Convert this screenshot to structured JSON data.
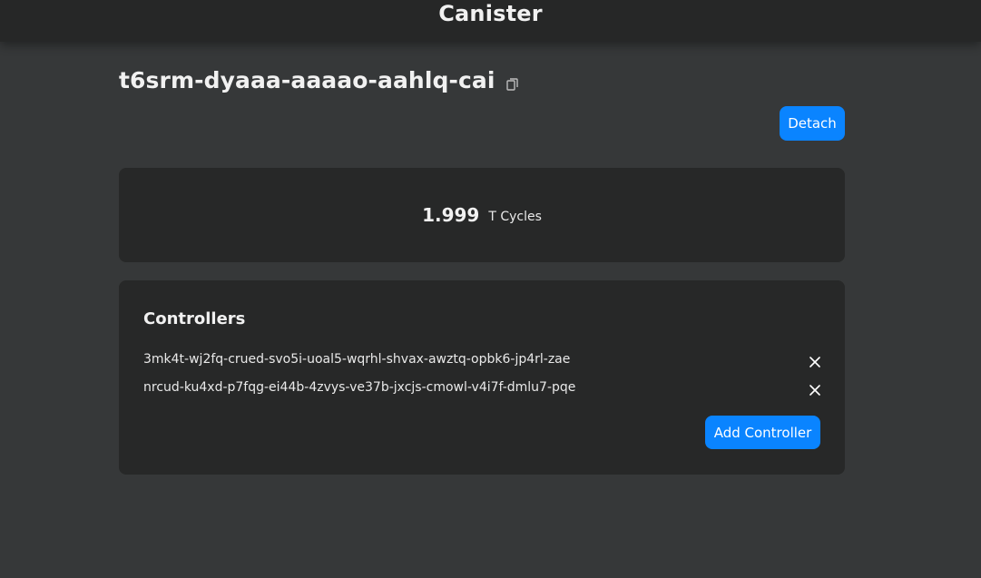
{
  "header": {
    "title": "Canister"
  },
  "canister": {
    "id": "t6srm-dyaaa-aaaao-aahlq-cai",
    "copy_icon": "copy-icon",
    "detach_label": "Detach"
  },
  "cycles": {
    "value": "1.999",
    "unit": "T Cycles"
  },
  "controllers": {
    "title": "Controllers",
    "items": [
      {
        "id": "3mk4t-wj2fq-crued-svo5i-uoal5-wqrhl-shvax-awztq-opbk6-jp4rl-zae",
        "remove_icon": "close-icon"
      },
      {
        "id": "nrcud-ku4xd-p7fqg-ei44b-4zvys-ve37b-jxcjs-cmowl-v4i7f-dmlu7-pqe",
        "remove_icon": "close-icon"
      }
    ],
    "add_label": "Add Controller"
  },
  "colors": {
    "background": "#363839",
    "topbar": "#262727",
    "card": "#272828",
    "accent": "#0a84ff",
    "text": "#e9e9e9"
  }
}
